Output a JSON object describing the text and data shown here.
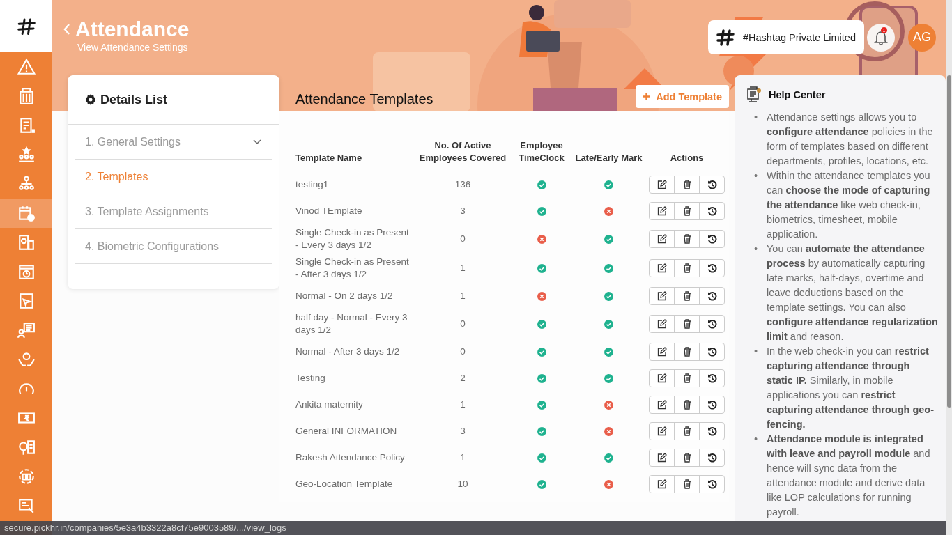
{
  "sidebar": {
    "items": [
      {
        "kind": "warning",
        "selected": false
      },
      {
        "kind": "building",
        "selected": false
      },
      {
        "kind": "document",
        "selected": false
      },
      {
        "kind": "star-group",
        "selected": false
      },
      {
        "kind": "hierarchy",
        "selected": false
      },
      {
        "kind": "calendar-check",
        "selected": true
      },
      {
        "kind": "report",
        "selected": false
      },
      {
        "kind": "calendar-clock",
        "selected": false
      },
      {
        "kind": "calendar-send",
        "selected": false
      },
      {
        "kind": "checklist",
        "selected": false
      },
      {
        "kind": "hands",
        "selected": false
      },
      {
        "kind": "gauge",
        "selected": false
      },
      {
        "kind": "money",
        "selected": false
      },
      {
        "kind": "chart-document",
        "selected": false
      },
      {
        "kind": "book-cycle",
        "selected": false
      },
      {
        "kind": "screen-document",
        "selected": false
      }
    ]
  },
  "header": {
    "title": "Attendance",
    "subtitle": "View Attendance Settings"
  },
  "company": {
    "name": "#Hashtag Private Limited"
  },
  "notifications": {
    "badge": "1"
  },
  "user": {
    "initials": "AG"
  },
  "details_list": {
    "title": "Details List",
    "items": [
      {
        "label": "1. General Settings",
        "selected": false,
        "expandable": true
      },
      {
        "label": "2. Templates",
        "selected": true,
        "expandable": false
      },
      {
        "label": "3. Template Assignments",
        "selected": false,
        "expandable": false
      },
      {
        "label": "4. Biometric Configurations",
        "selected": false,
        "expandable": false
      }
    ]
  },
  "templates": {
    "title": "Attendance Templates",
    "add_button": "Add Template",
    "columns": [
      "Template Name",
      "No. Of Active Employees Covered",
      "Employee TimeClock",
      "Late/Early Mark",
      "Actions"
    ],
    "rows": [
      {
        "name": "testing1",
        "employees": "136",
        "timeclock": true,
        "late_mark": true
      },
      {
        "name": "Vinod TEmplate",
        "employees": "3",
        "timeclock": true,
        "late_mark": false
      },
      {
        "name": "Single Check-in as Present - Every 3 days 1/2",
        "employees": "0",
        "timeclock": false,
        "late_mark": true
      },
      {
        "name": "Single Check-in as Present - After 3 days 1/2",
        "employees": "1",
        "timeclock": true,
        "late_mark": true
      },
      {
        "name": "Normal - On 2 days 1/2",
        "employees": "1",
        "timeclock": false,
        "late_mark": true
      },
      {
        "name": "half day - Normal - Every 3 days 1/2",
        "employees": "0",
        "timeclock": true,
        "late_mark": true
      },
      {
        "name": "Normal - After 3 days 1/2",
        "employees": "0",
        "timeclock": true,
        "late_mark": true
      },
      {
        "name": "Testing",
        "employees": "2",
        "timeclock": true,
        "late_mark": true
      },
      {
        "name": "Ankita maternity",
        "employees": "1",
        "timeclock": true,
        "late_mark": false
      },
      {
        "name": "General INFORMATION",
        "employees": "3",
        "timeclock": true,
        "late_mark": false
      },
      {
        "name": "Rakesh Attendance Policy",
        "employees": "1",
        "timeclock": true,
        "late_mark": true
      },
      {
        "name": "Geo-Location Template",
        "employees": "10",
        "timeclock": true,
        "late_mark": false
      }
    ]
  },
  "help_center": {
    "title": "Help Center",
    "bullets": [
      {
        "marker": "•",
        "text": "Attendance settings allows you to **configure attendance** policies in the form of templates based on different departments, profiles, locations, etc."
      },
      {
        "marker": "•",
        "text": "Within the attendance templates you can **choose the mode of capturing the attendance** like web check-in, biometrics, timesheet, mobile application."
      },
      {
        "marker": "•",
        "text": "You can **automate the attendance process** by automatically capturing late marks, half-days, overtime and leave deductions based on the template settings. You can also **configure attendance regularization limit** and reason."
      },
      {
        "marker": "•",
        "text": "In the web check-in you can **restrict capturing attendance through static IP.** Similarly, in mobile applications you can **restrict capturing attendance through geo-fencing.**"
      },
      {
        "marker": "•",
        "text": "**Attendance module is integrated with leave and payroll module** and hence will sync data from the attendance module and derive data like LOP calculations for running payroll."
      }
    ]
  },
  "status_bar": {
    "url": "secure.pickhr.in/companies/5e3a4b3322a8cf75e9003589/.../view_logs"
  }
}
